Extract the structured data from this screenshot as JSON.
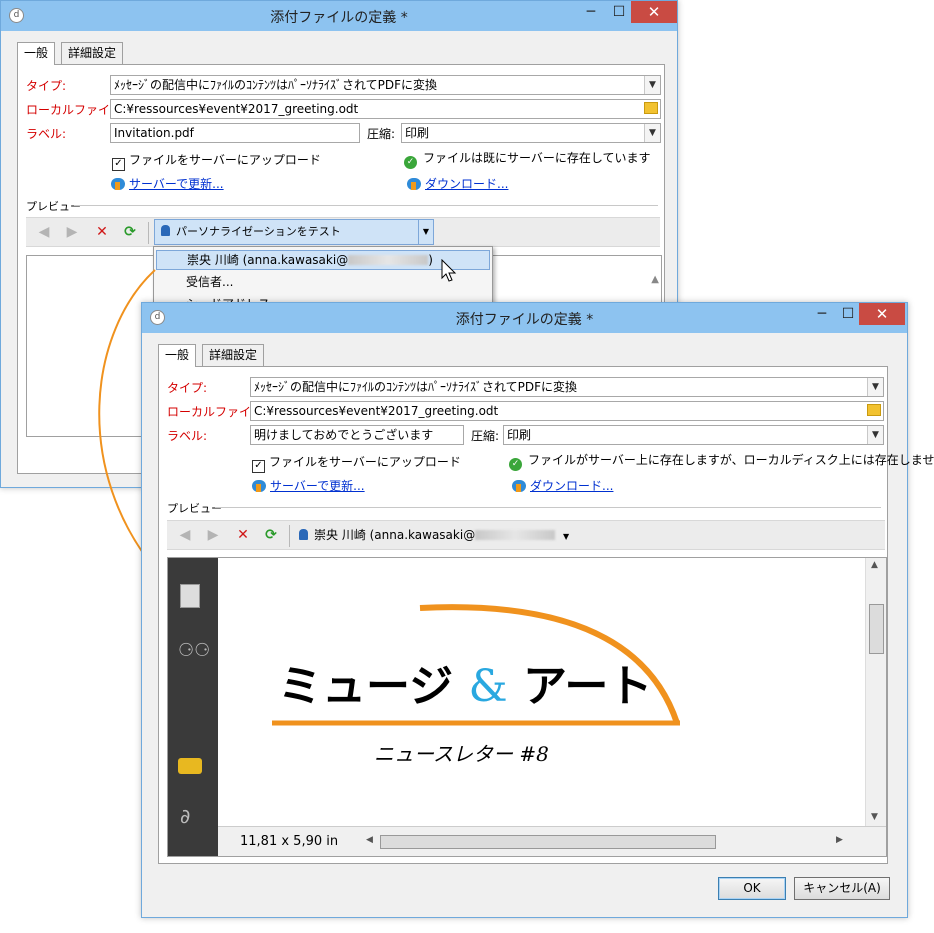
{
  "back_window": {
    "title": "添付ファイルの定義 *",
    "buttons": {
      "minimize": "─",
      "maximize": "☐",
      "close": "✕"
    },
    "tabs": [
      {
        "label": "一般"
      },
      {
        "label": "詳細設定"
      }
    ],
    "type_label": "タイプ:",
    "type_value": "ﾒｯｾｰｼﾞの配信中にﾌｧｲﾙのｺﾝﾃﾝﾂはﾊﾟｰｿﾅﾗｲｽﾞされてPDFに変換",
    "local_file_label": "ローカルファイル:",
    "local_file_value": "C:¥ressources¥event¥2017_greeting.odt",
    "label_label": "ラベル:",
    "label_value": "Invitation.pdf",
    "compression_label": "圧縮:",
    "compression_value": "印刷",
    "upload_checkbox": "ファイルをサーバーにアップロード",
    "status_text": "ファイルは既にサーバーに存在しています",
    "update_link": "サーバーで更新...",
    "download_link": "ダウンロード...",
    "preview_label": "プレビュー",
    "personalize_button": "パーソナライゼーションをテスト",
    "menu_items": [
      {
        "label": "崇央 川崎 (anna.kawasaki@",
        "suffix": ")"
      },
      {
        "label": "受信者..."
      },
      {
        "label": "シードアドレス"
      }
    ]
  },
  "front_window": {
    "title": "添付ファイルの定義 *",
    "buttons": {
      "minimize": "─",
      "maximize": "☐",
      "close": "✕"
    },
    "tabs": [
      {
        "label": "一般"
      },
      {
        "label": "詳細設定"
      }
    ],
    "type_label": "タイプ:",
    "type_value": "ﾒｯｾｰｼﾞの配信中にﾌｧｲﾙのｺﾝﾃﾝﾂはﾊﾟｰｿﾅﾗｲｽﾞされてPDFに変換",
    "local_file_label": "ローカルファイル:",
    "local_file_value": "C:¥ressources¥event¥2017_greeting.odt",
    "label_label": "ラベル:",
    "label_value": "明けましておめでとうございます",
    "compression_label": "圧縮:",
    "compression_value": "印刷",
    "upload_checkbox": "ファイルをサーバーにアップロード",
    "status_text": "ファイルがサーバー上に存在しますが、ローカルディスク上には存在しません",
    "update_link": "サーバーで更新...",
    "download_link": "ダウンロード...",
    "preview_label": "プレビュー",
    "recipient_selector": "崇央 川崎 (anna.kawasaki@",
    "pdf": {
      "title_left": "ミュージ",
      "ampersand": "&",
      "title_right": "アート",
      "subtitle": "ニュースレター #8",
      "page_size": "11,81 x 5,90 in"
    },
    "ok_button": "OK",
    "cancel_button": "キャンセル(A)"
  },
  "colors": {
    "titlebar": "#8dc3f0",
    "close_button": "#c94b43",
    "required_label": "#d40000",
    "link": "#0030d0",
    "arrow": "#f0921e",
    "ampersand": "#29a8e0"
  }
}
